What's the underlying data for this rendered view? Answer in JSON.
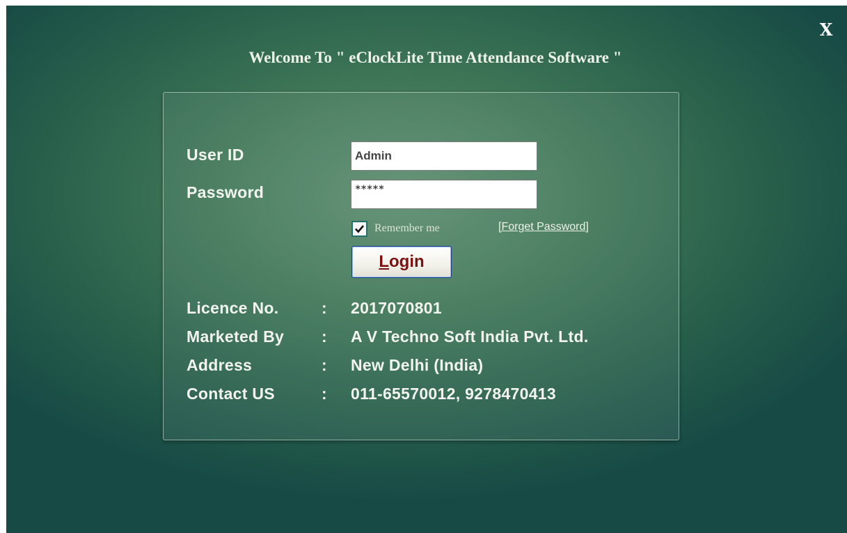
{
  "window": {
    "close_label": "X",
    "title": "Welcome To \" eClockLite Time Attendance Software \""
  },
  "login": {
    "user_id_label": "User ID",
    "user_id_value": "Admin",
    "password_label": "Password",
    "password_value": "*****",
    "remember_label": "Remember me",
    "remember_checked": true,
    "forget_password_link": "[Forget Password]",
    "login_button_mnemonic": "L",
    "login_button_rest": "ogin"
  },
  "info": {
    "rows": [
      {
        "label": "Licence No.",
        "colon": ":",
        "value": "2017070801"
      },
      {
        "label": "Marketed By",
        "colon": ":",
        "value": "A V Techno Soft India Pvt. Ltd."
      },
      {
        "label": "Address",
        "colon": ":",
        "value": "New Delhi (India)"
      },
      {
        "label": "Contact US",
        "colon": ":",
        "value": "011-65570012, 9278470413"
      }
    ]
  },
  "colors": {
    "background_center": "#5c8d70",
    "background_edge": "#174a45",
    "login_text": "#7a1212",
    "label_text": "#f2f5ef"
  },
  "icons": {
    "close": "close-icon",
    "checkbox": "checkmark-icon"
  }
}
